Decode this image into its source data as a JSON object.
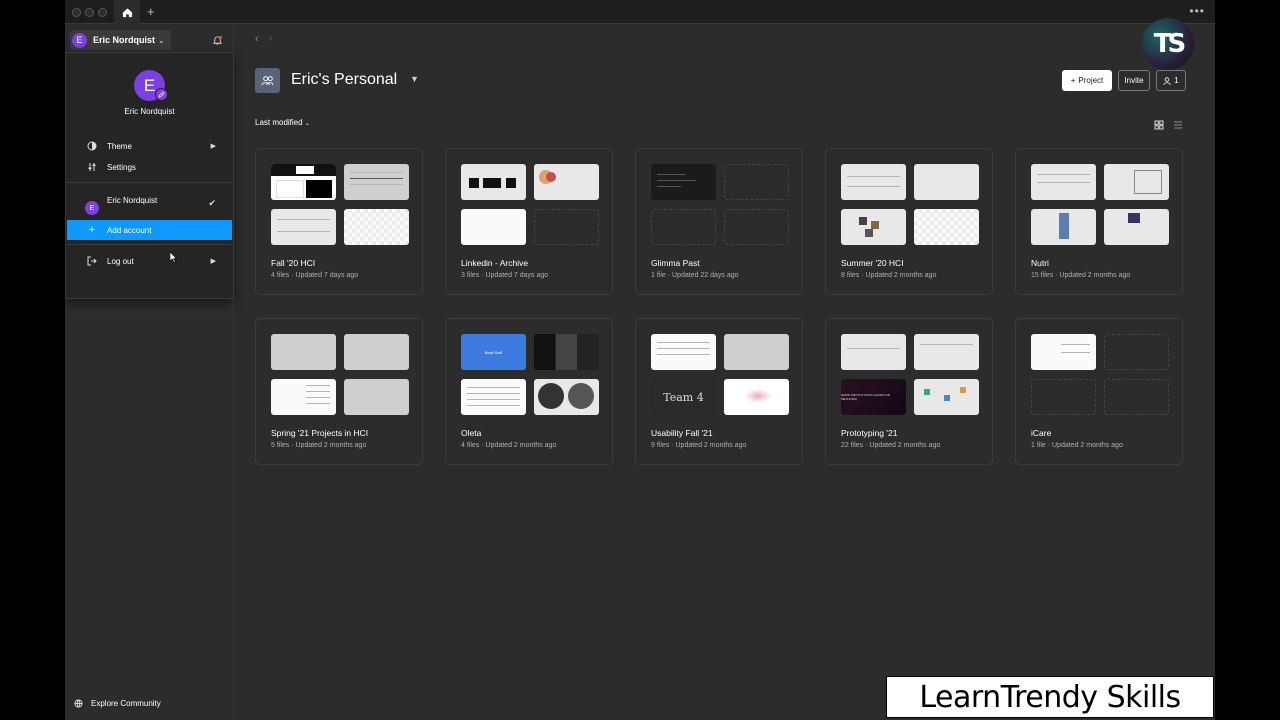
{
  "window": {
    "home_tab": "home-icon",
    "new_tab": "+",
    "more": "•••"
  },
  "account": {
    "initial": "E",
    "name": "Eric Nordquist"
  },
  "menu": {
    "user_name": "Eric Nordquist",
    "theme": "Theme",
    "settings": "Settings",
    "account_entry": "Eric Nordquist",
    "add_account": "Add account",
    "log_out": "Log out"
  },
  "sidebar": {
    "explore": "Explore Community"
  },
  "header": {
    "team_name": "Eric's Personal",
    "project_button": "Project",
    "invite_button": "Invite",
    "members_count": "1",
    "sort_label": "Last modified"
  },
  "projects": [
    {
      "name": "Fall '20 HCI",
      "meta": "4 files · Updated 7 days ago"
    },
    {
      "name": "Linkedin - Archive",
      "meta": "3 files · Updated 7 days ago"
    },
    {
      "name": "Glimma Past",
      "meta": "1 file · Updated 22 days ago"
    },
    {
      "name": "Summer '20 HCI",
      "meta": "8 files · Updated 2 months ago"
    },
    {
      "name": "Nutri",
      "meta": "15 files · Updated 2 months ago"
    },
    {
      "name": "Spring '21 Projects in HCI",
      "meta": "5 files · Updated 2 months ago"
    },
    {
      "name": "Oleta",
      "meta": "4 files · Updated 2 months ago"
    },
    {
      "name": "Usability Fall '21",
      "meta": "9 files · Updated 2 months ago"
    },
    {
      "name": "Prototyping '21",
      "meta": "22 files · Updated 2 months ago"
    },
    {
      "name": "iCare",
      "meta": "1 file · Updated 2 months ago"
    }
  ],
  "thumb_text": {
    "oleta": "Beat Stuff",
    "usability": "Team 4",
    "prototyping": "RAPID PROTOTYPING (LEARN OR METHODS)"
  },
  "overlay": {
    "logo": "TS",
    "watermark": "LearnTrendy Skills"
  },
  "colors": {
    "accent": "#0d99ff",
    "avatar": "#7b3fe4",
    "background": "#2c2c2c"
  }
}
